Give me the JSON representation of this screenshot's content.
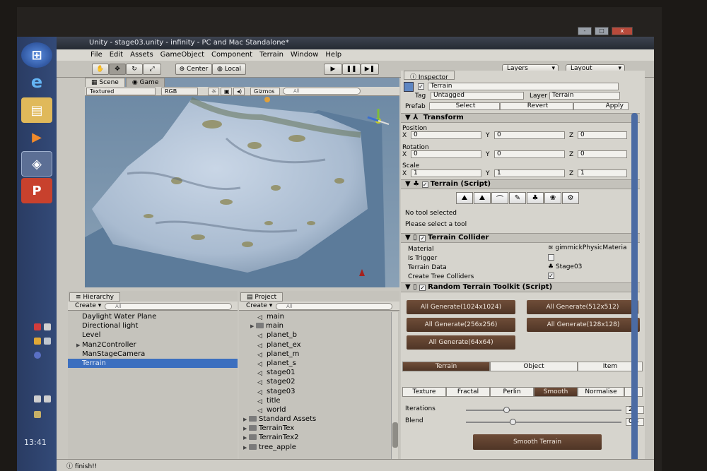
{
  "window": {
    "title": "Unity - stage03.unity - infinity - PC and Mac Standalone*",
    "controls": [
      "-",
      "□",
      "x"
    ]
  },
  "menu": [
    "File",
    "Edit",
    "Assets",
    "GameObject",
    "Component",
    "Terrain",
    "Window",
    "Help"
  ],
  "toolbar": {
    "transform_tools": [
      "hand-icon",
      "move-icon",
      "rotate-icon",
      "scale-icon"
    ],
    "pivot": "Center",
    "space": "Local",
    "layers_label": "Layers",
    "layout_label": "Layout"
  },
  "scene": {
    "tabs": [
      "Scene",
      "Game"
    ],
    "render_mode": "Textured",
    "color_mode": "RGB",
    "gizmos_label": "Gizmos",
    "search_placeholder": "All"
  },
  "hierarchy": {
    "tab": "Hierarchy",
    "create": "Create",
    "search_placeholder": "All",
    "items": [
      {
        "label": "Daylight Water Plane",
        "arrow": "",
        "selected": false
      },
      {
        "label": "Directional light",
        "arrow": "",
        "selected": false
      },
      {
        "label": "Level",
        "arrow": "",
        "selected": false
      },
      {
        "label": "Man2Controller",
        "arrow": "▶",
        "selected": false
      },
      {
        "label": "ManStageCamera",
        "arrow": "",
        "selected": false
      },
      {
        "label": "Terrain",
        "arrow": "",
        "selected": true
      }
    ]
  },
  "project": {
    "tab": "Project",
    "create": "Create",
    "search_placeholder": "All",
    "items": [
      {
        "label": "main",
        "kind": "unity",
        "indent": 2
      },
      {
        "label": "main",
        "kind": "folder",
        "indent": 1
      },
      {
        "label": "planet_b",
        "kind": "unity",
        "indent": 2
      },
      {
        "label": "planet_ex",
        "kind": "unity",
        "indent": 2
      },
      {
        "label": "planet_m",
        "kind": "unity",
        "indent": 2
      },
      {
        "label": "planet_s",
        "kind": "unity",
        "indent": 2
      },
      {
        "label": "stage01",
        "kind": "unity",
        "indent": 2
      },
      {
        "label": "stage02",
        "kind": "unity",
        "indent": 2
      },
      {
        "label": "stage03",
        "kind": "unity",
        "indent": 2
      },
      {
        "label": "title",
        "kind": "unity",
        "indent": 2
      },
      {
        "label": "world",
        "kind": "unity",
        "indent": 2
      },
      {
        "label": "Standard Assets",
        "kind": "folder",
        "indent": 0
      },
      {
        "label": "TerrainTex",
        "kind": "folder",
        "indent": 0
      },
      {
        "label": "TerrainTex2",
        "kind": "folder",
        "indent": 0
      },
      {
        "label": "tree_apple",
        "kind": "folder",
        "indent": 0
      }
    ]
  },
  "inspector": {
    "tab": "Inspector",
    "object_name": "Terrain",
    "tag_label": "Tag",
    "tag_value": "Untagged",
    "layer_label": "Layer",
    "layer_value": "Terrain",
    "prefab_label": "Prefab",
    "prefab_buttons": [
      "Select",
      "Revert",
      "Apply"
    ],
    "transform": {
      "title": "Transform",
      "position_label": "Position",
      "rotation_label": "Rotation",
      "scale_label": "Scale",
      "axes": [
        "X",
        "Y",
        "Z"
      ],
      "position": [
        "0",
        "0",
        "0"
      ],
      "rotation": [
        "0",
        "0",
        "0"
      ],
      "scale": [
        "1",
        "1",
        "1"
      ]
    },
    "terrain_script": {
      "title": "Terrain (Script)",
      "no_tool": "No tool selected",
      "hint": "Please select a tool"
    },
    "collider": {
      "title": "Terrain Collider",
      "material_label": "Material",
      "material_value": "gimmickPhysicMateria",
      "trigger_label": "Is Trigger",
      "data_label": "Terrain Data",
      "data_value": "Stage03",
      "trees_label": "Create Tree Colliders"
    },
    "toolkit": {
      "title": "Random Terrain Toolkit (Script)",
      "generate_buttons": [
        "All Generate(1024x1024)",
        "All Generate(512x512)",
        "All Generate(256x256)",
        "All Generate(128x128)",
        "All Generate(64x64)"
      ],
      "main_tabs": [
        "Terrain",
        "Object",
        "Item"
      ],
      "main_selected": 0,
      "sub_tabs": [
        "Texture",
        "Fractal",
        "Perlin",
        "Smooth",
        "Normalise",
        "B"
      ],
      "sub_selected": 3,
      "iterations_label": "Iterations",
      "iterations_value": "2",
      "iterations_level": 0.26,
      "blend_label": "Blend",
      "blend_value": "0.3",
      "blend_level": 0.3,
      "smooth_button": "Smooth Terrain"
    }
  },
  "status": "finish!!",
  "taskbar": {
    "clock": "13:41"
  }
}
